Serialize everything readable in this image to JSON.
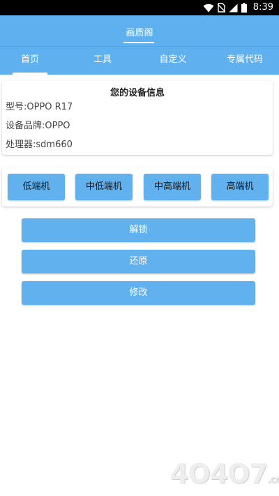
{
  "status_bar": {
    "time": "8:39",
    "icons": [
      "wifi-icon",
      "no-sim-icon",
      "signal-icon",
      "battery-icon"
    ]
  },
  "app": {
    "title": "画质阁"
  },
  "tabs": [
    {
      "label": "首页",
      "active": true
    },
    {
      "label": "工具",
      "active": false
    },
    {
      "label": "自定义",
      "active": false
    },
    {
      "label": "专属代码",
      "active": false
    }
  ],
  "device_info": {
    "title": "您的设备信息",
    "model": "型号:OPPO R17",
    "brand": "设备品牌:OPPO",
    "processor": "处理器:sdm660"
  },
  "tiers": [
    {
      "label": "低端机"
    },
    {
      "label": "中低端机"
    },
    {
      "label": "中高端机"
    },
    {
      "label": "高端机"
    }
  ],
  "actions": {
    "unlock": "解锁",
    "restore": "还原",
    "modify": "修改"
  },
  "watermark": {
    "text": "4O4O7",
    "suffix": ".com"
  },
  "colors": {
    "primary": "#5fb0ef",
    "button": "#61b1ef",
    "status_bar": "#000000"
  }
}
